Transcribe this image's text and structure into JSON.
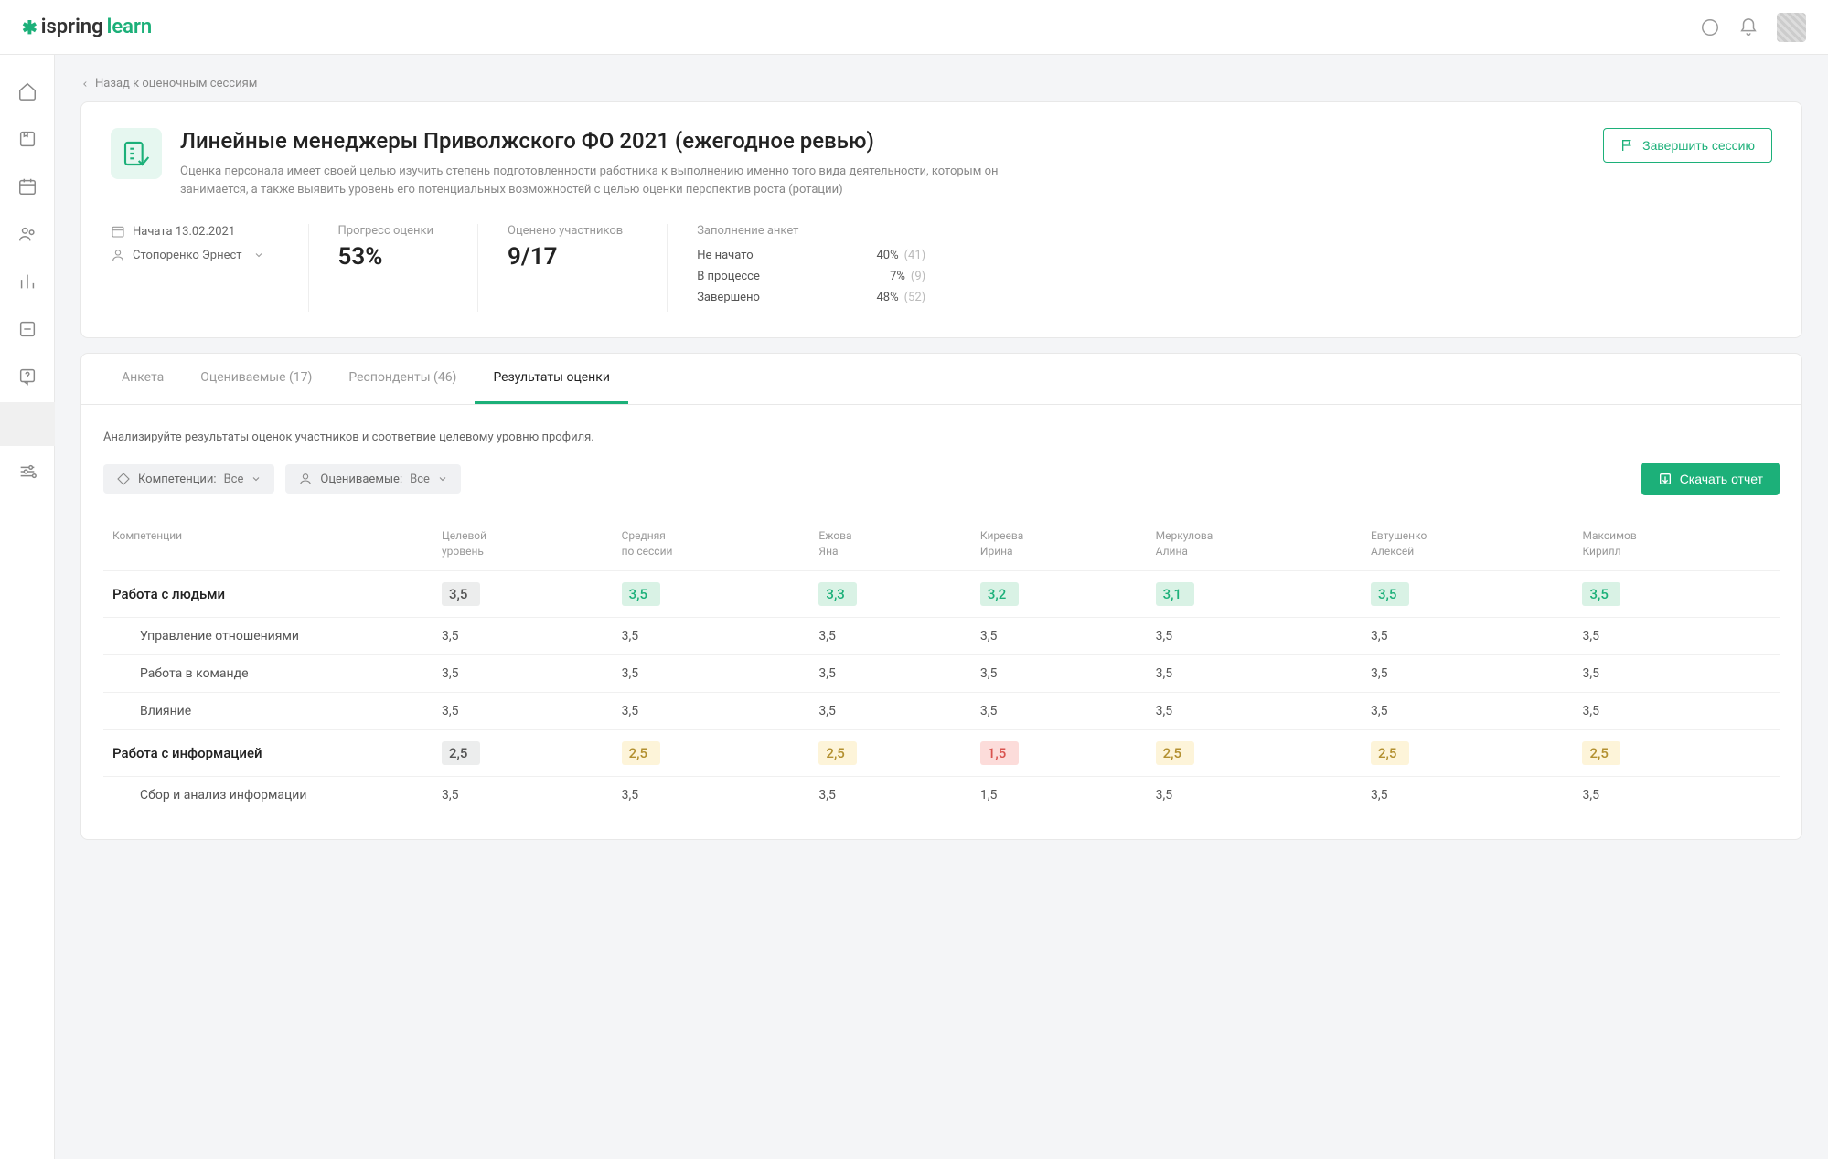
{
  "logo": {
    "text1": "ispring",
    "text2": "learn"
  },
  "back": "Назад к оценочным сессиям",
  "session": {
    "title": "Линейные менеджеры Приволжского ФО 2021 (ежегодное ревью)",
    "description": "Оценка персонала имеет своей целью изучить степень подготовленности работника к выполнению именно того вида деятельности, которым он занимается, а также выявить уровень его потенциальных возможностей с целью оценки перспектив роста (ротации)",
    "started": "Начата 13.02.2021",
    "owner": "Стопоренко Эрнест",
    "progress_label": "Прогресс оценки",
    "progress_value": "53%",
    "evaluated_label": "Оценено участников",
    "evaluated_value": "9/17",
    "survey_label": "Заполнение анкет",
    "survey": [
      {
        "label": "Не начато",
        "pct": "40%",
        "count": "(41)"
      },
      {
        "label": "В процессе",
        "pct": "7%",
        "count": "(9)"
      },
      {
        "label": "Завершено",
        "pct": "48%",
        "count": "(52)"
      }
    ],
    "complete_btn": "Завершить сессию"
  },
  "tabs": [
    {
      "label": "Анкета"
    },
    {
      "label": "Оцениваемые (17)"
    },
    {
      "label": "Респонденты (46)"
    },
    {
      "label": "Результаты оценки"
    }
  ],
  "results": {
    "desc": "Анализируйте результаты оценок участников и соответвие целевому уровню профиля.",
    "filter_comp_label": "Компетенции:",
    "filter_comp_val": "Все",
    "filter_eval_label": "Оцениваемые:",
    "filter_eval_val": "Все",
    "download_btn": "Скачать отчет",
    "columns": [
      "Компетенции",
      "Целевой уровень",
      "Средняя по сессии",
      "Ежова Яна",
      "Киреева Ирина",
      "Меркулова Алина",
      "Евтушенко Алексей",
      "Максимов Кирилл"
    ],
    "rows": [
      {
        "type": "group",
        "name": "Работа с людьми",
        "cells": [
          {
            "v": "3,5",
            "cls": "bg-gray"
          },
          {
            "v": "3,5",
            "cls": "bg-green"
          },
          {
            "v": "3,3",
            "cls": "bg-green"
          },
          {
            "v": "3,2",
            "cls": "bg-green"
          },
          {
            "v": "3,1",
            "cls": "bg-green"
          },
          {
            "v": "3,5",
            "cls": "bg-green"
          },
          {
            "v": "3,5",
            "cls": "bg-green"
          }
        ]
      },
      {
        "type": "sub",
        "name": "Управление отношениями",
        "cells": [
          {
            "v": "3,5",
            "cls": "txt-dark"
          },
          {
            "v": "3,5",
            "cls": "txt-green"
          },
          {
            "v": "3,5",
            "cls": "txt-green"
          },
          {
            "v": "3,5",
            "cls": "txt-green"
          },
          {
            "v": "3,5",
            "cls": "txt-green"
          },
          {
            "v": "3,5",
            "cls": "txt-green"
          },
          {
            "v": "3,5",
            "cls": "txt-green"
          }
        ]
      },
      {
        "type": "sub",
        "name": "Работа в команде",
        "cells": [
          {
            "v": "3,5",
            "cls": "txt-dark"
          },
          {
            "v": "3,5",
            "cls": "txt-green"
          },
          {
            "v": "3,5",
            "cls": "txt-green"
          },
          {
            "v": "3,5",
            "cls": "txt-green"
          },
          {
            "v": "3,5",
            "cls": "txt-green"
          },
          {
            "v": "3,5",
            "cls": "txt-green"
          },
          {
            "v": "3,5",
            "cls": "txt-green"
          }
        ]
      },
      {
        "type": "sub",
        "name": "Влияние",
        "cells": [
          {
            "v": "3,5",
            "cls": "txt-dark"
          },
          {
            "v": "3,5",
            "cls": "txt-green"
          },
          {
            "v": "3,5",
            "cls": "txt-green"
          },
          {
            "v": "3,5",
            "cls": "txt-green"
          },
          {
            "v": "3,5",
            "cls": "txt-green"
          },
          {
            "v": "3,5",
            "cls": "txt-green"
          },
          {
            "v": "3,5",
            "cls": "txt-green"
          }
        ]
      },
      {
        "type": "group",
        "name": "Работа с информацией",
        "cells": [
          {
            "v": "2,5",
            "cls": "bg-gray"
          },
          {
            "v": "2,5",
            "cls": "bg-yellow"
          },
          {
            "v": "2,5",
            "cls": "bg-yellow"
          },
          {
            "v": "1,5",
            "cls": "bg-red"
          },
          {
            "v": "2,5",
            "cls": "bg-yellow"
          },
          {
            "v": "2,5",
            "cls": "bg-yellow"
          },
          {
            "v": "2,5",
            "cls": "bg-yellow"
          }
        ]
      },
      {
        "type": "sub",
        "name": "Сбор и анализ информации",
        "cells": [
          {
            "v": "3,5",
            "cls": "txt-dark"
          },
          {
            "v": "3,5",
            "cls": "txt-dark"
          },
          {
            "v": "3,5",
            "cls": "txt-dark"
          },
          {
            "v": "1,5",
            "cls": "txt-dark"
          },
          {
            "v": "3,5",
            "cls": "txt-dark"
          },
          {
            "v": "3,5",
            "cls": "txt-dark"
          },
          {
            "v": "3,5",
            "cls": "txt-dark"
          }
        ]
      }
    ]
  }
}
